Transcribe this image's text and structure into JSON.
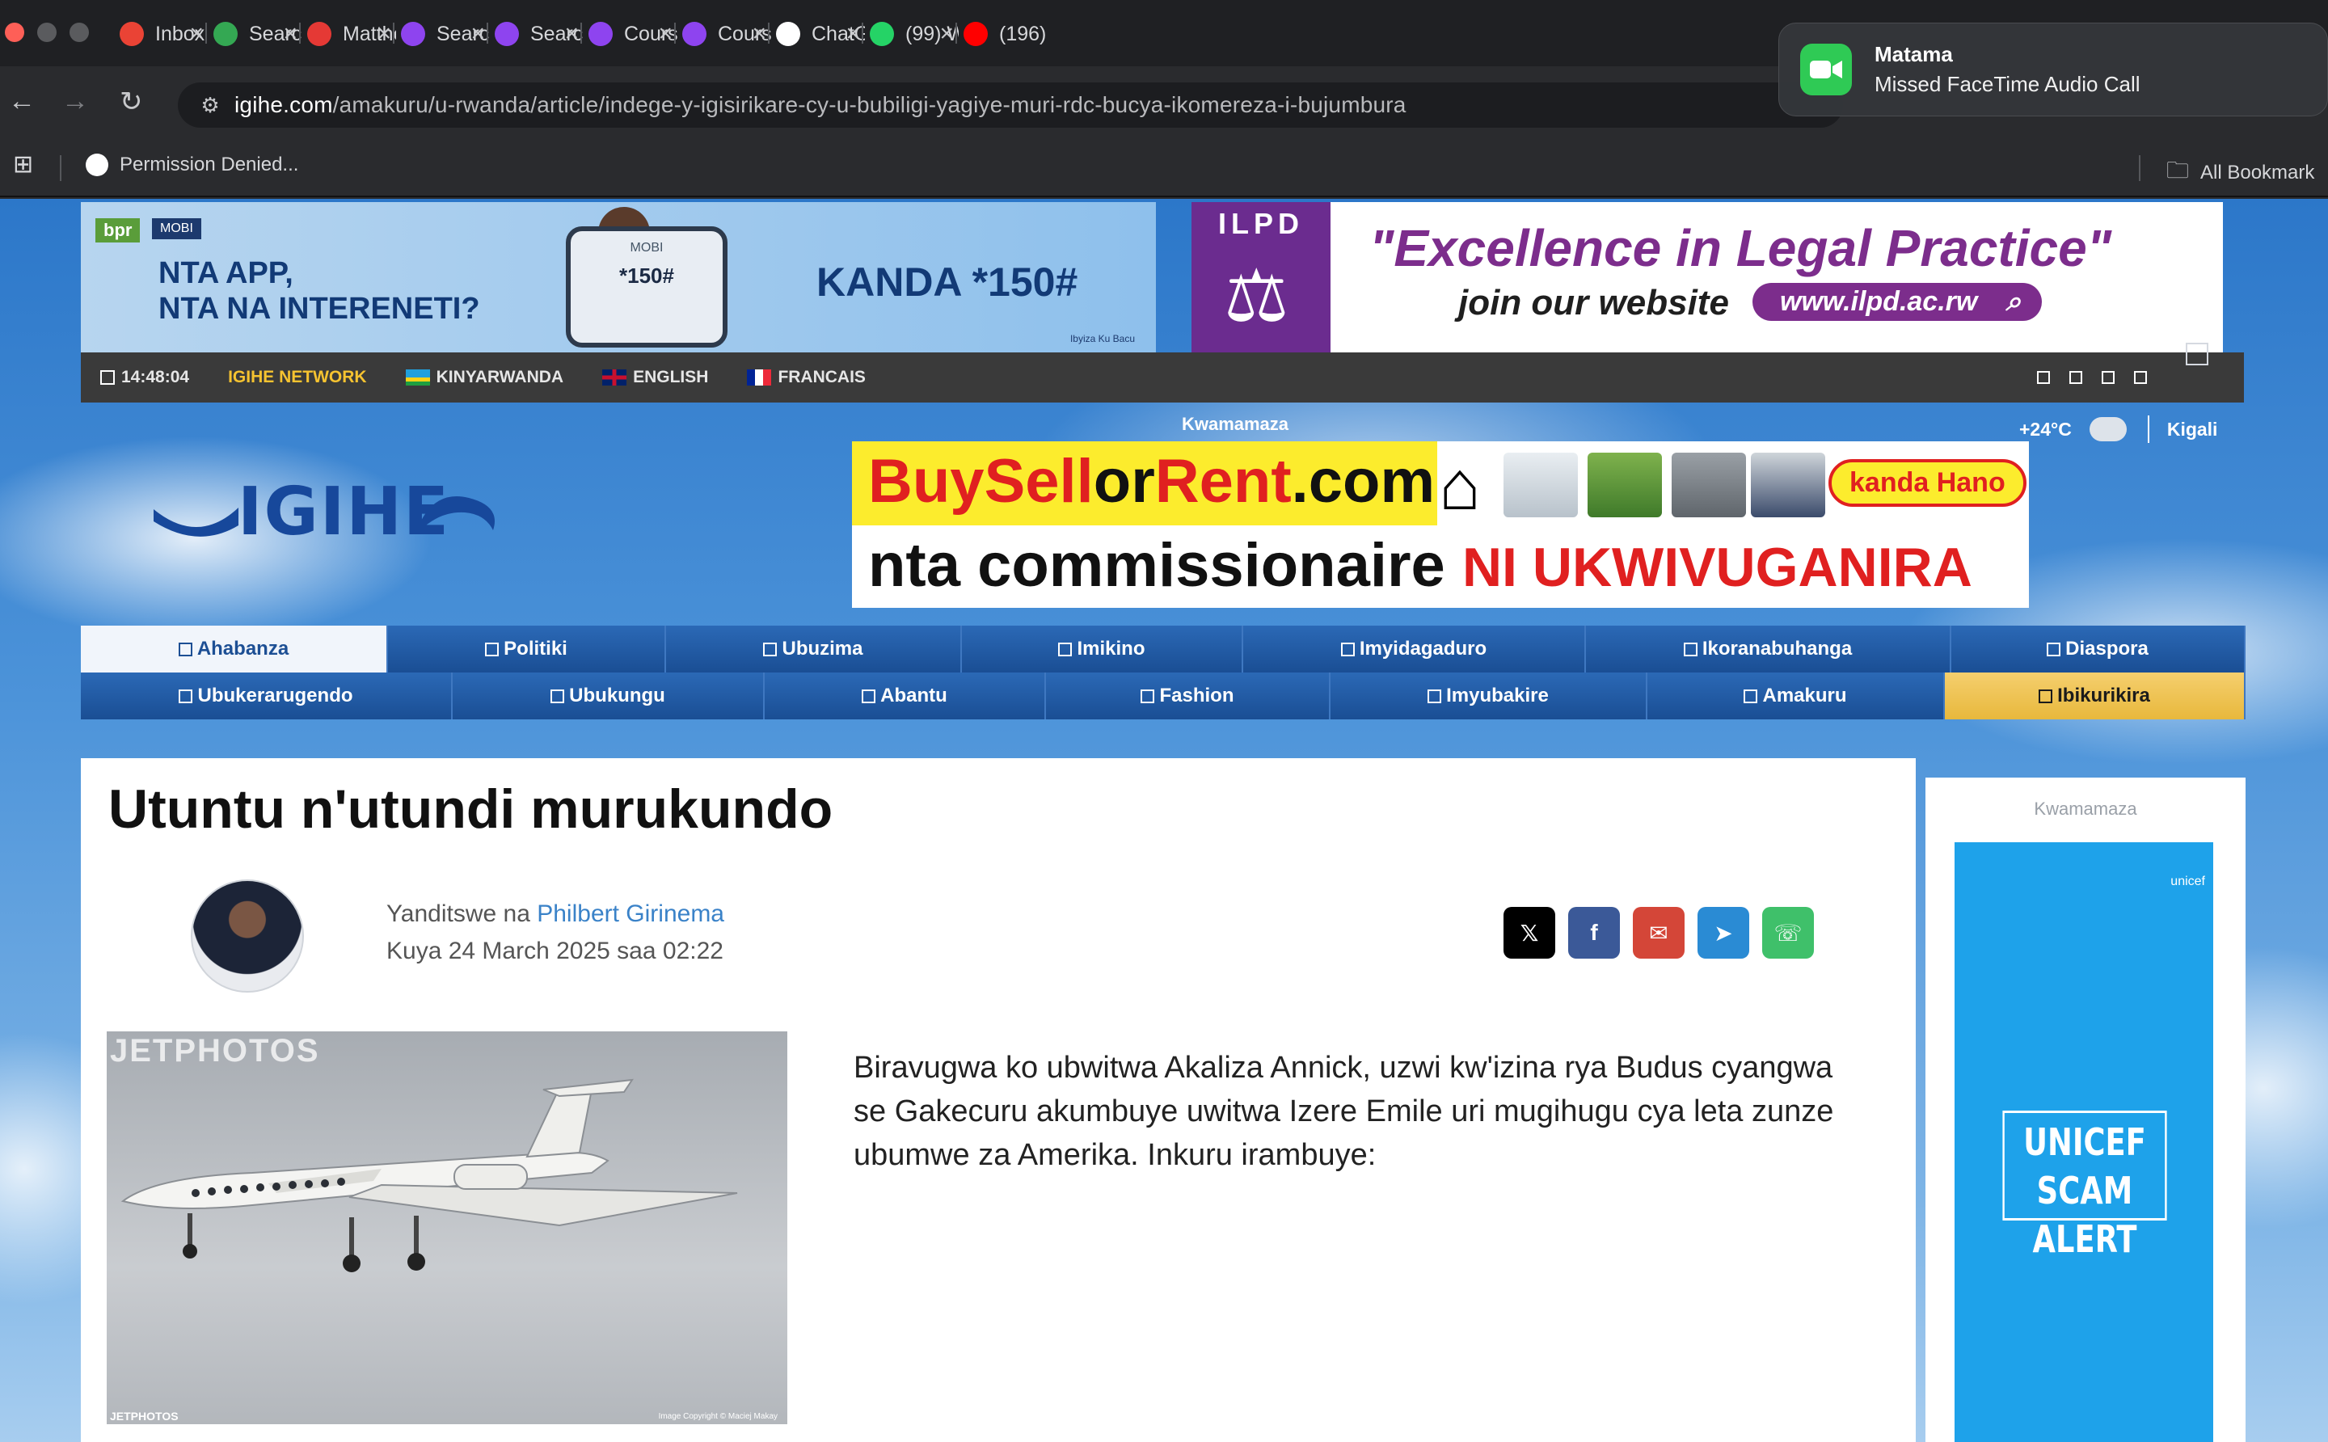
{
  "browser": {
    "tabs": [
      {
        "label": "Inbox",
        "icon": "gmail-icon",
        "color": "#ea4335"
      },
      {
        "label": "Search",
        "icon": "google-drive-icon",
        "color": "#34a853"
      },
      {
        "label": "Matthe",
        "icon": "headset-icon",
        "color": "#e53935"
      },
      {
        "label": "Search",
        "icon": "udemy-icon",
        "color": "#8e44ef"
      },
      {
        "label": "Search",
        "icon": "udemy-icon",
        "color": "#8e44ef"
      },
      {
        "label": "Course",
        "icon": "udemy-icon",
        "color": "#8e44ef"
      },
      {
        "label": "Course",
        "icon": "udemy-icon",
        "color": "#8e44ef"
      },
      {
        "label": "ChatG",
        "icon": "chatgpt-icon",
        "color": "#ffffff"
      },
      {
        "label": "(99) W",
        "icon": "whatsapp-icon",
        "color": "#25d366"
      },
      {
        "label": "(196)",
        "icon": "youtube-icon",
        "color": "#ff0000"
      }
    ],
    "url_host": "igihe.com",
    "url_path": "/amakuru/u-rwanda/article/indege-y-igisirikare-cy-u-bubiligi-yagiye-muri-rdc-bucya-ikomereza-i-bujumbura",
    "bookmark": "Permission Denied...",
    "all_bookmarks": "All Bookmark"
  },
  "notification": {
    "title": "Matama",
    "message": "Missed FaceTime Audio Call",
    "app_color": "#2fca55"
  },
  "ads": {
    "bpr": {
      "brand": "bpr",
      "brand_sub": "MOBI",
      "line1": "NTA APP,",
      "line2": "NTA NA INTERENETI?",
      "phone_top": "MOBI",
      "phone_code": "*150#",
      "kanda": "KANDA *150#",
      "small": "Ibyiza Ku Bacu"
    },
    "ilpd": {
      "logo": "ILPD",
      "quote": "\"Excellence in Legal Practice\"",
      "join": "join our website",
      "web": "www.ilpd.ac.rw"
    },
    "bsr": {
      "site_a": "BuySell",
      "site_b": "or",
      "site_c": "Rent",
      "site_d": ".com",
      "line2_a": "nta commissionaire",
      "line2_b": "NI UKWIVUGANIRA",
      "cta": "kanda Hano"
    },
    "unicef": {
      "logo": "unicef",
      "line1": "UNICEF",
      "line2": "SCAM ALERT"
    }
  },
  "topbar": {
    "time": "14:48:04",
    "network": "IGIHE NETWORK",
    "lang1": "KINYARWANDA",
    "lang2": "ENGLISH",
    "lang3": "FRANCAIS"
  },
  "weather": {
    "label": "Kwamamaza",
    "temp": "+24°C",
    "city": "Kigali"
  },
  "site_logo": "IGIHE",
  "nav": {
    "row1": [
      "Ahabanza",
      "Politiki",
      "Ubuzima",
      "Imikino",
      "Imyidagaduro",
      "Ikoranabuhanga",
      "Diaspora"
    ],
    "row2": [
      "Ubukerarugendo",
      "Ubukungu",
      "Abantu",
      "Fashion",
      "Imyubakire",
      "Amakuru",
      "Ibikurikira"
    ]
  },
  "article": {
    "title": "Utuntu n'utundi murukundo",
    "byline_prefix": "Yanditswe na ",
    "author": "Philbert Girinema",
    "date": "Kuya 24 March 2025 saa 02:22",
    "photo_watermark": "JETPHOTOS",
    "photo_watermark_small": "JETPHOTOS",
    "photo_copyright": "Image Copyright © Maciej Makay",
    "body": "Biravugwa ko ubwitwa Akaliza Annick, uzwi kw'izina rya Budus cyangwa se Gakecuru akumbuye uwitwa Izere Emile uri mugihugu cya leta zunze ubumwe za Amerika. Inkuru irambuye:"
  },
  "share": {
    "x": "𝕏",
    "facebook": "f",
    "email": "✉",
    "telegram": "➤",
    "whatsapp": "☏"
  },
  "sidebar": {
    "label": "Kwamamaza"
  }
}
